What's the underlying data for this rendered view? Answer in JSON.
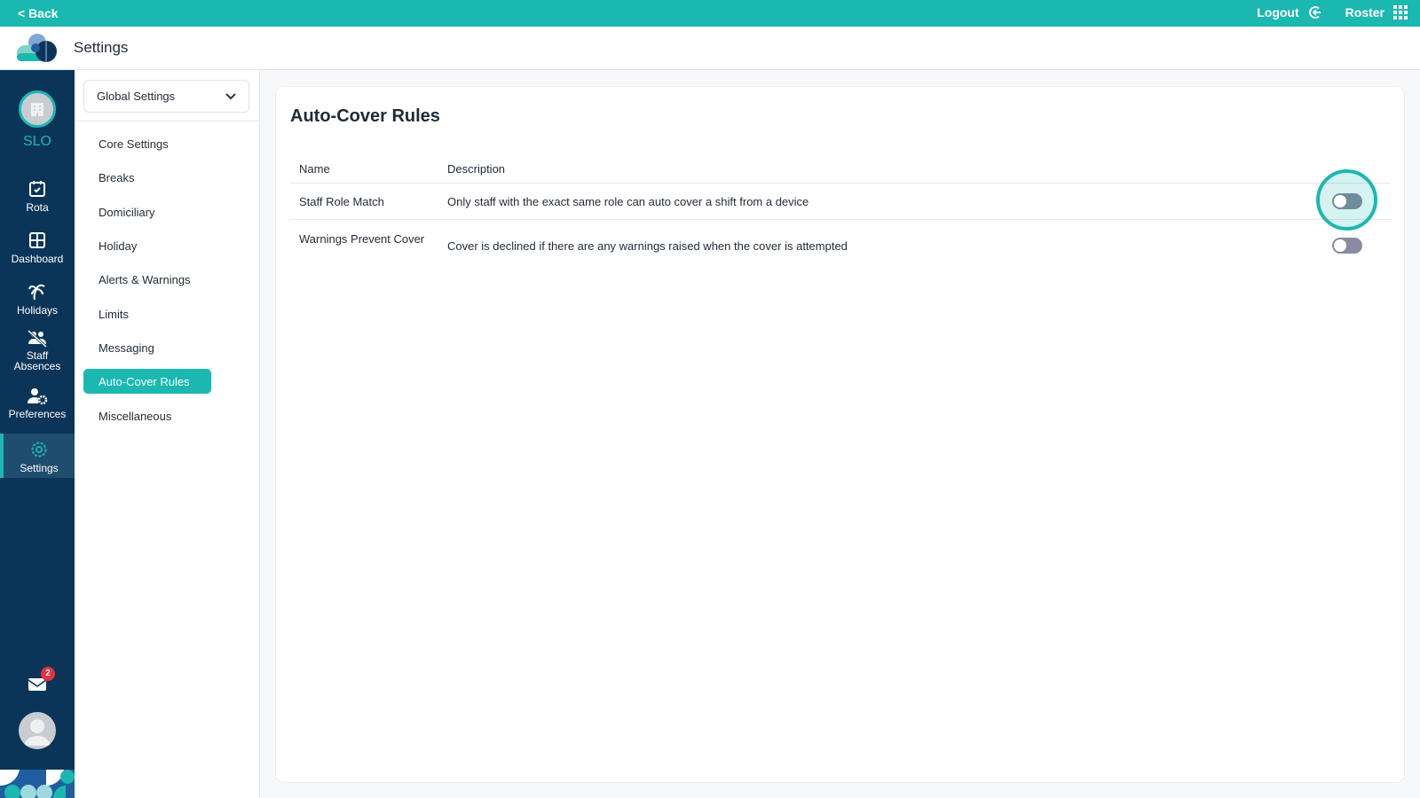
{
  "topbar": {
    "back": "< Back",
    "logout": "Logout",
    "roster": "Roster"
  },
  "header": {
    "title": "Settings"
  },
  "sidebar": {
    "org": "SLO",
    "items": [
      {
        "label": "Rota"
      },
      {
        "label": "Dashboard"
      },
      {
        "label": "Holidays"
      },
      {
        "label": "Staff Absences"
      },
      {
        "label": "Preferences"
      },
      {
        "label": "Settings",
        "active": true
      }
    ],
    "mail_badge": "2"
  },
  "subnav": {
    "dropdown": "Global Settings",
    "items": [
      "Core Settings",
      "Breaks",
      "Domiciliary",
      "Holiday",
      "Alerts & Warnings",
      "Limits",
      "Messaging",
      "Auto-Cover Rules",
      "Miscellaneous"
    ],
    "active": "Auto-Cover Rules"
  },
  "main": {
    "title": "Auto-Cover Rules",
    "columns": [
      "Name",
      "Description"
    ],
    "rows": [
      {
        "name": "Staff Role Match",
        "description": "Only staff with the exact same role can auto cover a shift from a device",
        "enabled": false
      },
      {
        "name": "Warnings Prevent Cover",
        "description": "Cover is declined if there are any warnings raised when the cover is attempted",
        "enabled": false
      }
    ]
  },
  "colors": {
    "accent": "#1bb8b0",
    "sidebar": "#0b3558",
    "badge": "#e5323f"
  }
}
